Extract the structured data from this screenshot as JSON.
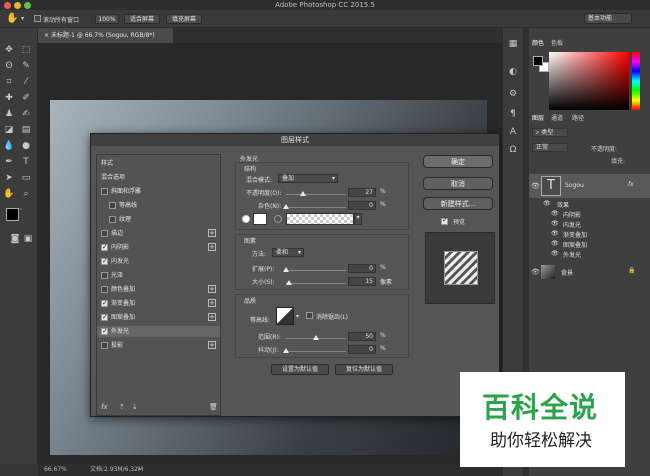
{
  "app_title": "Adobe Photoshop CC 2015.5",
  "options": {
    "scroll_all_label": "滚动所有窗口",
    "zoom_btn": "100%",
    "fit_btn": "适合屏幕",
    "fill_btn": "填充屏幕",
    "workspace": "基本功能"
  },
  "doc_tab": "未标题-1 @ 66.7% (Sogou, RGB/8*)",
  "status": {
    "zoom": "66.67%",
    "doc_size": "文档:2.93M/6.32M"
  },
  "dialog": {
    "title": "图层样式",
    "list_header": "样式",
    "blend_options": "混合选项",
    "items": [
      {
        "label": "斜面和浮雕",
        "checked": false,
        "plus": false
      },
      {
        "label": "等高线",
        "checked": false,
        "plus": false
      },
      {
        "label": "纹理",
        "checked": false,
        "plus": false
      },
      {
        "label": "描边",
        "checked": false,
        "plus": true
      },
      {
        "label": "内阴影",
        "checked": true,
        "plus": true
      },
      {
        "label": "内发光",
        "checked": true,
        "plus": false
      },
      {
        "label": "光泽",
        "checked": false,
        "plus": false
      },
      {
        "label": "颜色叠加",
        "checked": false,
        "plus": true
      },
      {
        "label": "渐变叠加",
        "checked": true,
        "plus": true
      },
      {
        "label": "图案叠加",
        "checked": true,
        "plus": true
      },
      {
        "label": "外发光",
        "checked": true,
        "plus": false
      },
      {
        "label": "投影",
        "checked": false,
        "plus": true
      }
    ],
    "fx": "fx",
    "section_title": "外发光",
    "structure": {
      "title": "结构",
      "blend_mode_label": "混合模式:",
      "blend_mode_value": "叠加",
      "opacity_label": "不透明度(O):",
      "opacity_value": "27",
      "noise_label": "杂色(N):",
      "noise_value": "0",
      "percent": "%"
    },
    "elements": {
      "title": "图素",
      "method_label": "方法:",
      "method_value": "柔和",
      "spread_label": "扩展(P):",
      "spread_value": "0",
      "size_label": "大小(S):",
      "size_value": "15",
      "px": "像素"
    },
    "quality": {
      "title": "品质",
      "contour_label": "等高线:",
      "antialias_label": "消除锯齿(L)",
      "range_label": "范围(R):",
      "range_value": "50",
      "jitter_label": "抖动(J):",
      "jitter_value": "0"
    },
    "set_default": "设置为默认值",
    "reset_default": "复位为默认值",
    "ok": "确定",
    "cancel": "取消",
    "new_style": "新建样式...",
    "preview": "预览"
  },
  "panels": {
    "color_tabs": [
      "颜色",
      "色板"
    ],
    "layer_tabs": [
      "图层",
      "通道",
      "路径"
    ],
    "kind": "类型",
    "blend": "正常",
    "opacity": "不透明度:",
    "fill": "填充:",
    "layer_name": "Sogou",
    "effects_label": "效果",
    "effects": [
      "内阴影",
      "内发光",
      "渐变叠加",
      "图案叠加",
      "外发光"
    ],
    "bg_layer": "背景",
    "fx": "fx"
  },
  "watermark": {
    "title": "百科全说",
    "subtitle": "助你轻松解决"
  }
}
